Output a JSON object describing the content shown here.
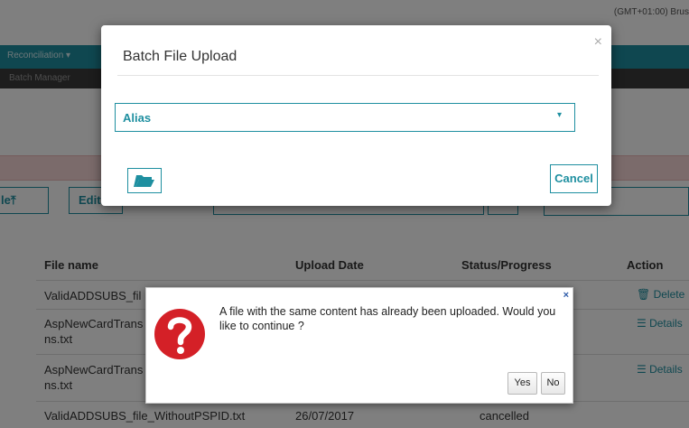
{
  "app": {
    "timezone": "(GMT+01:00) Brus",
    "menu": "Reconciliation ▾",
    "submenu": "Batch Manager"
  },
  "toolbar": {
    "upload_btn": "le⤒",
    "edit_btn": "Edit"
  },
  "table": {
    "headers": [
      "File name",
      "Upload Date",
      "Status/Progress",
      "Action"
    ],
    "rows": [
      {
        "file": "ValidADDSUBS_fil",
        "action": "Delete"
      },
      {
        "file": "AspNewCardTrans ns.txt",
        "action": "Details"
      },
      {
        "file": "AspNewCardTrans ns.txt",
        "action": "Details"
      },
      {
        "file": "ValidADDSUBS_file_WithoutPSPID.txt",
        "date": "26/07/2017",
        "status": "cancelled"
      }
    ]
  },
  "upload_modal": {
    "title": "Batch File Upload",
    "close": "×",
    "select_value": "Alias",
    "select_caret": "▾",
    "cancel_label": "Cancel"
  },
  "confirm": {
    "close": "×",
    "icon": "question-mark-icon",
    "message": "A file with the same content has already been uploaded. Would you like to continue ?",
    "yes_label": "Yes",
    "no_label": "No"
  },
  "colors": {
    "accent": "#1e8fa0",
    "icon_red": "#d42027"
  }
}
